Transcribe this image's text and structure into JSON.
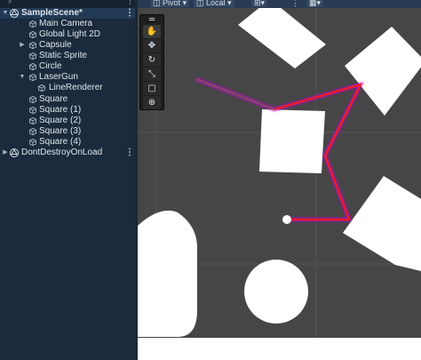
{
  "hierarchy": {
    "scene": {
      "label": "SampleScene*",
      "more": "⋮"
    },
    "items": [
      {
        "label": "Main Camera"
      },
      {
        "label": "Global Light 2D"
      },
      {
        "label": "Capsule"
      },
      {
        "label": "Static Sprite"
      },
      {
        "label": "Circle"
      },
      {
        "label": "LaserGun"
      },
      {
        "label": "LineRenderer"
      },
      {
        "label": "Square"
      },
      {
        "label": "Square (1)"
      },
      {
        "label": "Square (2)"
      },
      {
        "label": "Square (3)"
      },
      {
        "label": "Square (4)"
      }
    ],
    "dont_destroy": {
      "label": "DontDestroyOnLoad",
      "more": "⋮"
    }
  },
  "toolbar": {
    "pivot": "Pivot",
    "local": "Local"
  },
  "scene_tools": {
    "items": [
      "hand-tool",
      "move-tool",
      "rotate-tool",
      "scale-tool",
      "rect-tool",
      "transform-tool"
    ]
  },
  "colors": {
    "laser": "#ff1a1a",
    "laser_glow": "#d400d4",
    "viewport_bg": "#464646",
    "shape_fill": "#ffffff",
    "hierarchy_bg": "#1b2b3d"
  }
}
